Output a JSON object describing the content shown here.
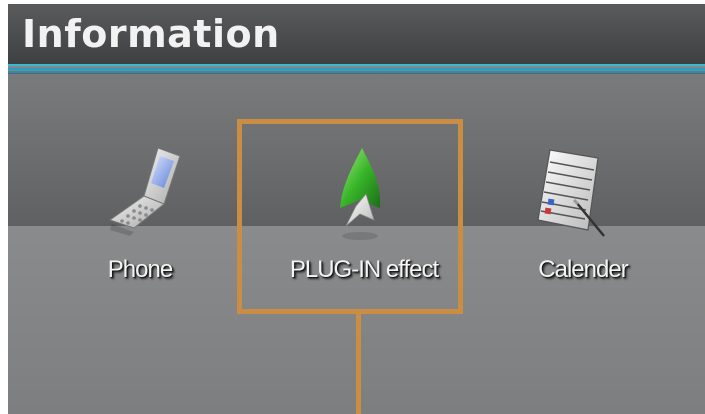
{
  "header": {
    "title": "Information"
  },
  "icons": [
    {
      "label": "Phone",
      "icon": "phone-icon"
    },
    {
      "label": "PLUG-IN effect",
      "icon": "plugin-effect-icon"
    },
    {
      "label": "Calender",
      "icon": "calendar-icon"
    }
  ],
  "colors": {
    "highlight": "#c98e43",
    "accent_stripe": "#3fb7cf"
  }
}
